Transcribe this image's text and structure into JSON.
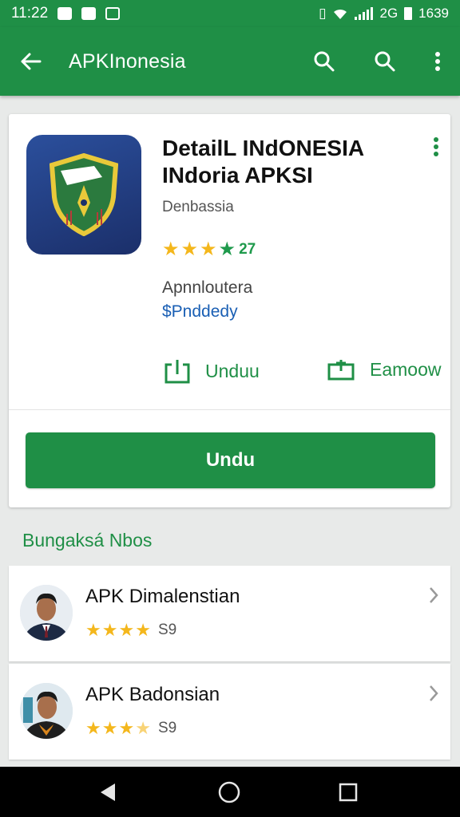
{
  "status_bar": {
    "time": "11:22",
    "network": "2G",
    "battery_text": "1639"
  },
  "app_bar": {
    "title": "APKInonesia",
    "back_icon": "arrow-left-icon",
    "search_icon": "search-icon",
    "more_icon": "more-vert-icon"
  },
  "app_detail": {
    "title": "DetailL INdONESIA INdoria APKSI",
    "developer": "Denbassia",
    "rating_value": "27",
    "stars": 4,
    "meta_label": "Apnnloutera",
    "meta_link": "$Pnddedy",
    "action_download_label": "Unduu",
    "action_share_label": "Eamoow",
    "install_button_label": "Undu"
  },
  "section": {
    "title": "Bungaksá Nbos"
  },
  "list": [
    {
      "title": "APK Dimalenstian",
      "stars": 4,
      "count": "S9"
    },
    {
      "title": "APK Badonsian",
      "stars": 3.5,
      "count": "S9"
    }
  ],
  "colors": {
    "primary": "#1f8f46",
    "star": "#f4b71c",
    "link": "#1a5fb4"
  }
}
